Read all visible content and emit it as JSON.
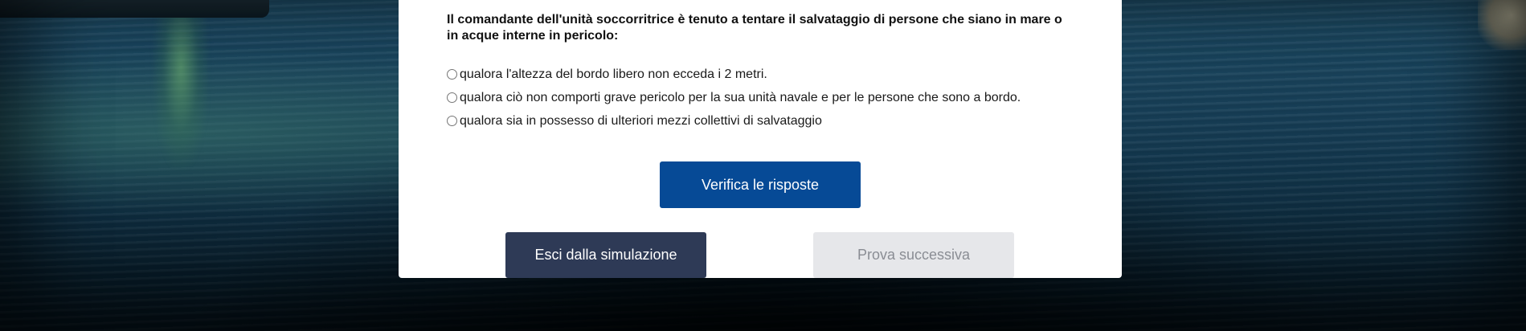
{
  "quiz": {
    "question": "Il comandante dell'unità soccorritrice è tenuto a tentare il salvataggio di persone che siano in mare o in acque interne in pericolo:",
    "options": [
      {
        "label": "qualora l'altezza del bordo libero non ecceda i 2 metri.",
        "selected": false
      },
      {
        "label": "qualora ciò non comporti grave pericolo per la sua unità navale e per le persone che sono a bordo.",
        "selected": false
      },
      {
        "label": "qualora sia in possesso di ulteriori mezzi collettivi di salvataggio",
        "selected": false
      }
    ],
    "verify_label": "Verifica le risposte",
    "exit_label": "Esci dalla simulazione",
    "next_label": "Prova successiva"
  },
  "colors": {
    "verify_button": "#064a96",
    "exit_button": "#2e3a56",
    "next_button_disabled": "#e6e7ea",
    "panel": "#ffffff"
  }
}
